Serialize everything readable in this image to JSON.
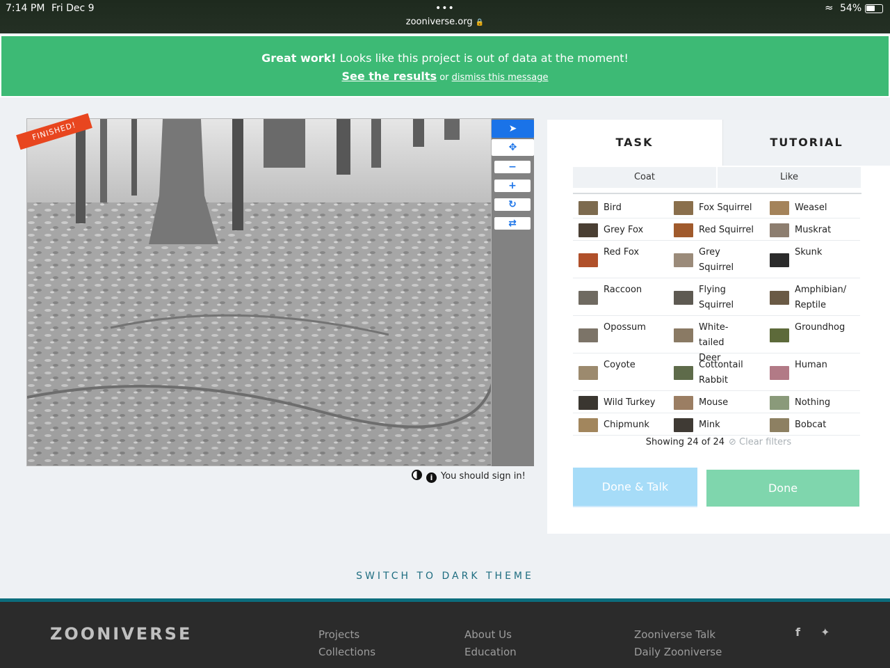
{
  "status_bar": {
    "time": "7:14 PM",
    "date": "Fri Dec 9",
    "dots": "•••",
    "url": "zooniverse.org",
    "battery": "54%"
  },
  "banner": {
    "bold": "Great work!",
    "message": " Looks like this project is out of data at the moment!",
    "results_link": "See the results",
    "or": " or ",
    "dismiss_link": "dismiss this message"
  },
  "viewer": {
    "ribbon": "FINISHED!",
    "signin": "You should sign in!"
  },
  "panel": {
    "tabs": [
      "TASK",
      "TUTORIAL"
    ],
    "filters": [
      "Coat",
      "Like"
    ],
    "species": [
      [
        "Bird",
        "Fox Squirrel",
        "Weasel"
      ],
      [
        "Grey Fox",
        "Red Squirrel",
        "Muskrat"
      ],
      [
        "Red Fox",
        "Grey Squirrel",
        "Skunk"
      ],
      [
        "Raccoon",
        "Flying Squirrel",
        "Amphibian/ Reptile"
      ],
      [
        "Opossum",
        "White-tailed Deer",
        "Groundhog"
      ],
      [
        "Coyote",
        "Cottontail Rabbit",
        "Human"
      ],
      [
        "Wild Turkey",
        "Mouse",
        "Nothing"
      ],
      [
        "Chipmunk",
        "Mink",
        "Bobcat"
      ]
    ],
    "showing": "Showing 24 of 24",
    "clear_filters": "Clear filters",
    "done_talk": "Done & Talk",
    "done": "Done"
  },
  "theme_switch": "SWITCH TO DARK THEME",
  "footer": {
    "logo": "ZOONIVERSE",
    "col1": [
      "Projects",
      "Collections"
    ],
    "col2": [
      "About Us",
      "Education"
    ],
    "col3": [
      "Zooniverse Talk",
      "Daily Zooniverse"
    ]
  },
  "colors": {
    "banner": "#3dba75",
    "accent_blue": "#1a73e8",
    "ribbon": "#e8461f",
    "done": "#7fd6ad",
    "done_talk": "#a6dcf8",
    "footer": "#2b2b2b"
  },
  "icons": [
    "pointer-icon",
    "move-icon",
    "zoom-out-icon",
    "zoom-in-icon",
    "rotate-icon",
    "reset-icon",
    "contrast-icon",
    "info-icon",
    "wifi-icon",
    "battery-icon",
    "lock-icon",
    "facebook-icon",
    "twitter-icon"
  ]
}
